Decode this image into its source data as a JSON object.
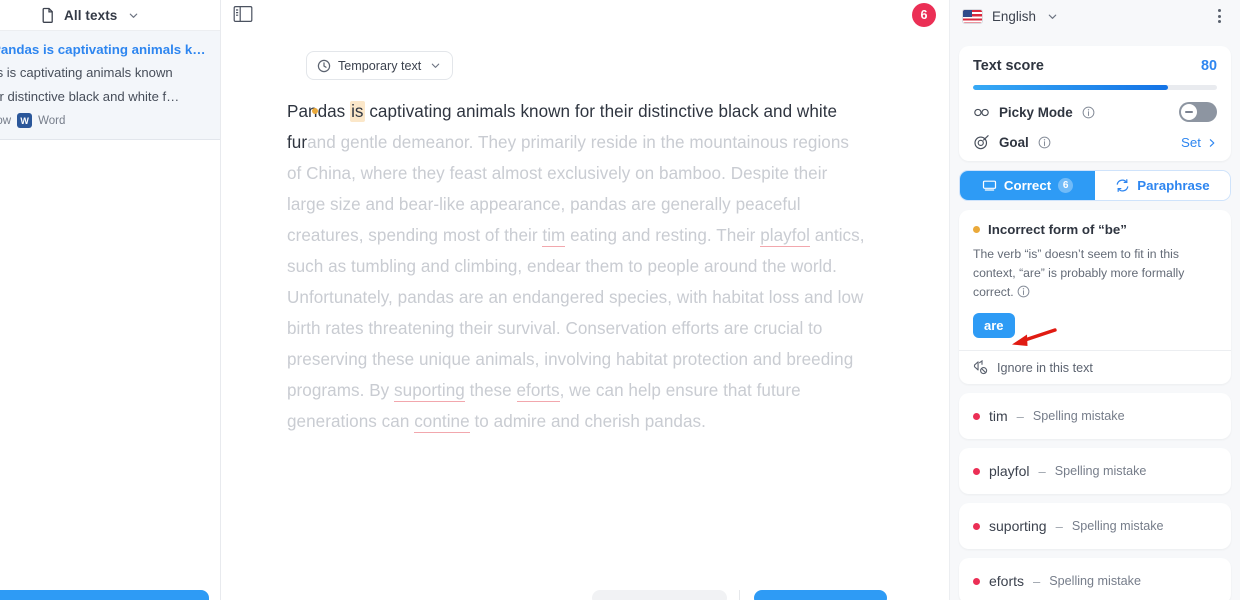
{
  "left_sidebar": {
    "header": {
      "icon": "document-icon",
      "title": "All texts",
      "chevron": "chevron-down-icon"
    },
    "text_card": {
      "title": "Pandas is captivating animals k…",
      "snippet": "das is captivating animals known their distinctive black and white f…",
      "snippet_line1": "das is captivating animals known",
      "snippet_line2": "heir distinctive black and white f…",
      "time": "now",
      "source_badge": "W",
      "source_label": "Word"
    }
  },
  "editor": {
    "panel_toggle_icon": "sidebar-toggle-icon",
    "status_pill": {
      "icon": "clock-icon",
      "label": "Temporary text",
      "chevron": "chevron-down-icon"
    },
    "document": {
      "bullet": "•",
      "lead_before": "Pandas ",
      "highlighted_word": "is",
      "lead_after": " captivating animals known for their distinctive black and white fur",
      "rest_1": "and gentle demeanor. They primarily reside in the mountainous regions of China, where they feast almost exclusively on bamboo. Despite their large size and bear-like appearance, pandas are generally peaceful creatures, spending most of their ",
      "err_tim": "tim",
      "rest_2": " eating and resting. Their ",
      "err_playfol": "playfol",
      "rest_3": " antics, such as tumbling and climbing, endear them to people around the world. Unfortunately, pandas are an endangered species, with habitat loss and low birth rates threatening their survival. Conservation efforts are crucial to preserving these unique animals, involving habitat protection and breeding programs. By ",
      "err_suporting": "suporting",
      "rest_4": " these ",
      "err_eforts": "eforts",
      "rest_5": ", we can help ensure that future generations can ",
      "err_contine": "contine",
      "rest_6": " to admire and cherish pandas."
    }
  },
  "notification_badge": "6",
  "right_panel": {
    "header": {
      "flag": "us-flag-icon",
      "language": "English",
      "chevron": "chevron-down-icon",
      "menu": "kebab-menu-icon"
    },
    "score": {
      "label": "Text score",
      "value": "80",
      "percent": 80
    },
    "picky_mode": {
      "icon": "picky-mode-icon",
      "label": "Picky Mode",
      "info": "info-icon",
      "enabled": false
    },
    "goal": {
      "icon": "target-icon",
      "label": "Goal",
      "info": "info-icon",
      "action": "Set",
      "chevron": "chevron-right-icon"
    },
    "tabs": [
      {
        "label": "Correct",
        "icon": "correct-icon",
        "count": "6",
        "active": true
      },
      {
        "label": "Paraphrase",
        "icon": "paraphrase-icon",
        "count": "",
        "active": false
      }
    ],
    "suggestion": {
      "title": "Incorrect form of “be”",
      "description": "The verb “is” doesn’t seem to fit in this context, “are” is probably more formally correct.",
      "info": "info-icon",
      "replacement": "are",
      "ignore_label": "Ignore in this text",
      "ignore_icon": "ignore-icon"
    },
    "issues": [
      {
        "word": "tim",
        "dash": "–",
        "type": "Spelling mistake"
      },
      {
        "word": "playfol",
        "dash": "–",
        "type": "Spelling mistake"
      },
      {
        "word": "suporting",
        "dash": "–",
        "type": "Spelling mistake"
      },
      {
        "word": "eforts",
        "dash": "–",
        "type": "Spelling mistake"
      }
    ]
  },
  "colors": {
    "accent_blue": "#2e9bf5",
    "link_blue": "#2e86f0",
    "badge_red": "#eb2f55",
    "warn_amber": "#eaa93a",
    "underline_red": "#f2a7ad",
    "annotation_red": "#e01b12"
  }
}
